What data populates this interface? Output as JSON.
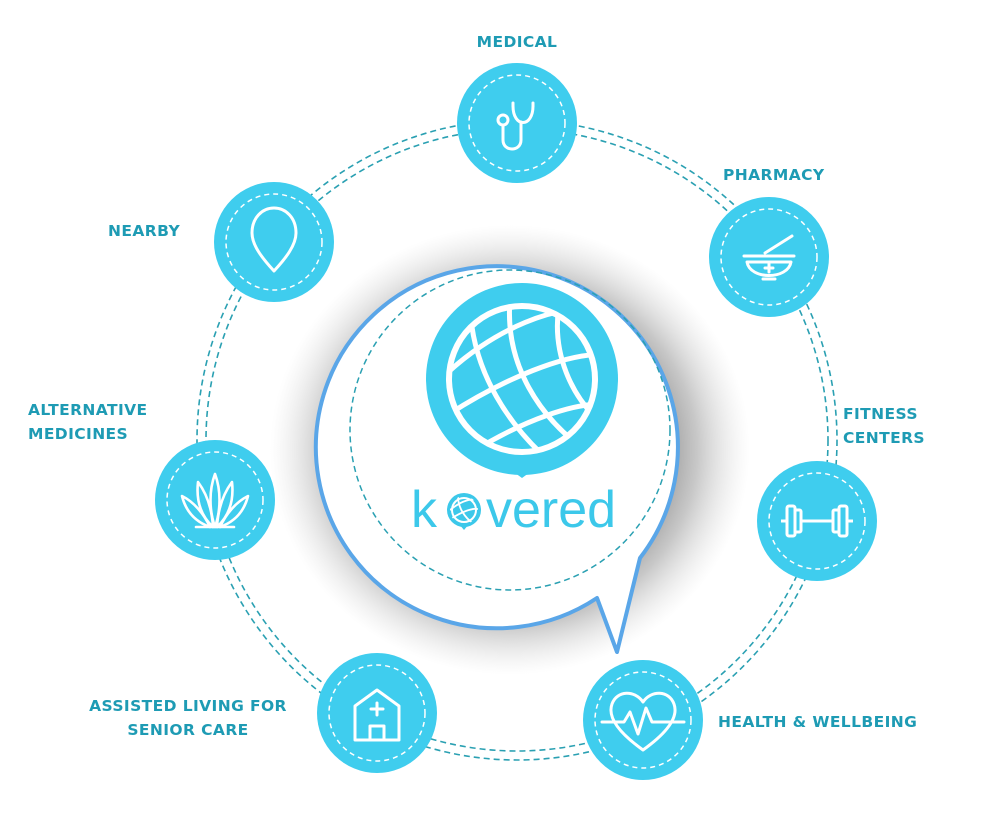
{
  "brand": {
    "wordmark_pre": "k",
    "wordmark_post": "vered",
    "logo_icon": "globe-pin-icon"
  },
  "colors": {
    "primary": "#3fcdee",
    "label": "#1e9bb4",
    "ring_dash": "#2aa0b2",
    "bubble_border": "#5aa6e8",
    "wordmark": "#3cc8ea"
  },
  "services": [
    {
      "key": "medical",
      "label": "MEDICAL",
      "icon": "stethoscope-icon"
    },
    {
      "key": "pharmacy",
      "label": "PHARMACY",
      "icon": "mortar-pestle-icon"
    },
    {
      "key": "fitness",
      "label": "FITNESS\nCENTERS",
      "icon": "dumbbell-icon"
    },
    {
      "key": "health",
      "label": "HEALTH & WELLBEING",
      "icon": "heart-pulse-icon"
    },
    {
      "key": "assisted",
      "label": "ASSISTED LIVING FOR\nSENIOR CARE",
      "icon": "house-cross-icon"
    },
    {
      "key": "alternative",
      "label": "ALTERNATIVE\nMEDICINES",
      "icon": "aloe-plant-icon"
    },
    {
      "key": "nearby",
      "label": "NEARBY",
      "icon": "location-pin-icon"
    }
  ]
}
